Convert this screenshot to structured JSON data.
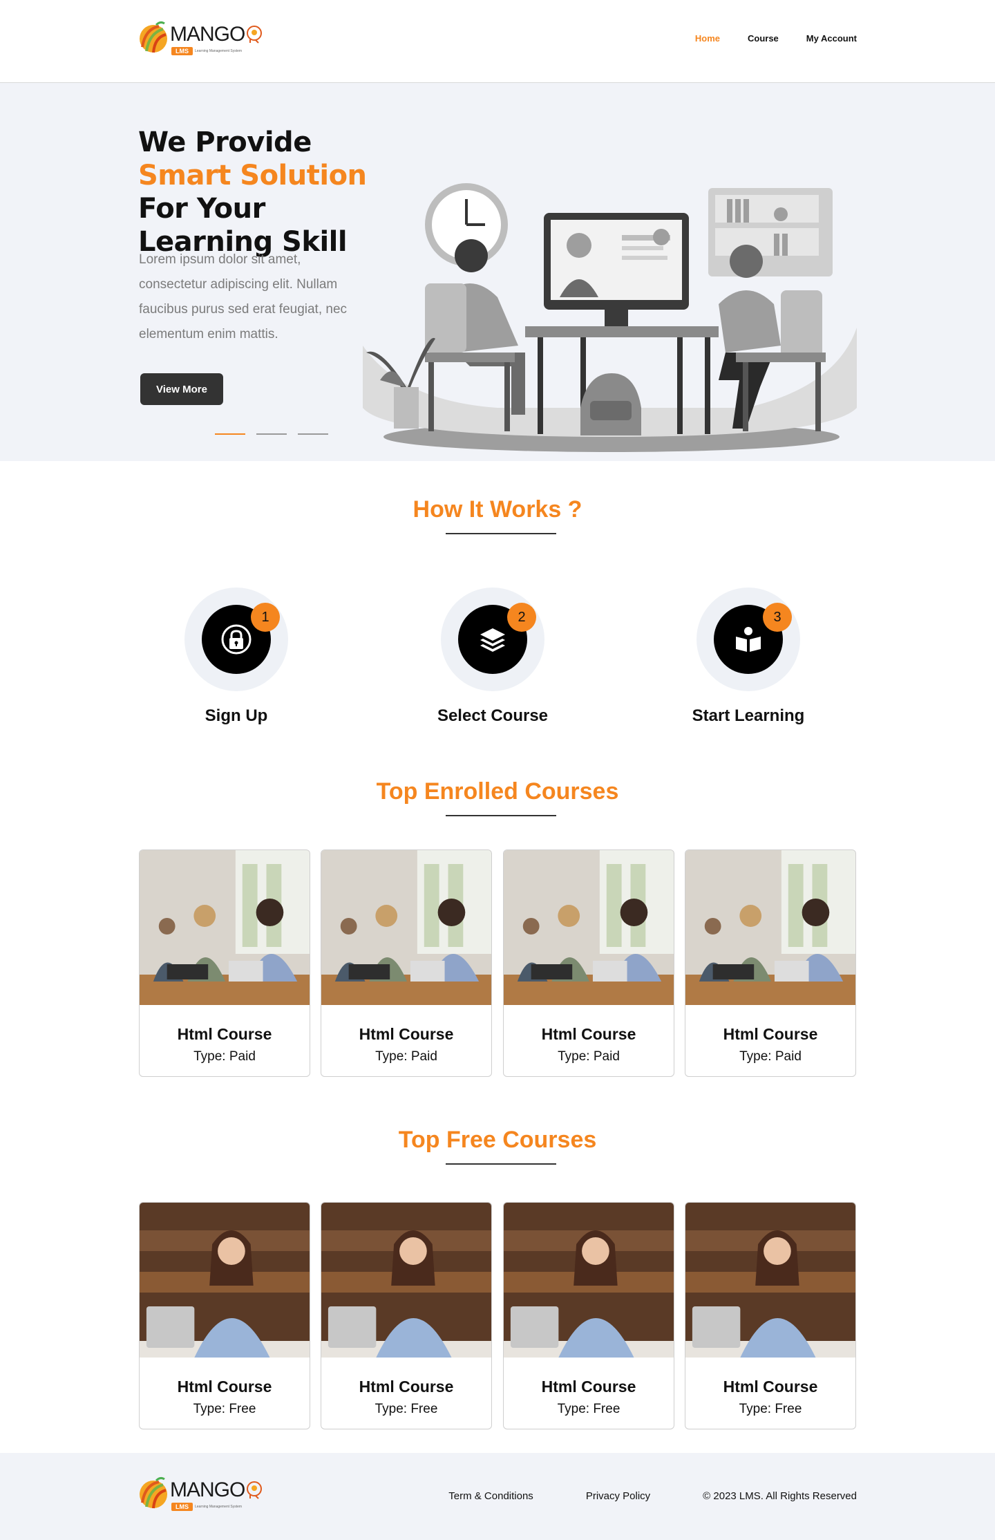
{
  "brand": {
    "name": "MANGO",
    "badge": "LMS",
    "tagline": "Learning Management System"
  },
  "nav": {
    "items": [
      "Home",
      "Course",
      "My Account"
    ],
    "active": "Home"
  },
  "hero": {
    "title_part1": "We Provide ",
    "title_highlight": "Smart Solution",
    "title_part2": " For Your Learning Skill",
    "description": "Lorem ipsum dolor sit amet, consectetur adipiscing elit. Nullam faucibus purus sed erat feugiat, nec elementum enim mattis.",
    "button_label": "View More",
    "slides_total": 3,
    "slides_active": 1
  },
  "how_it_works": {
    "title": "How It Works ?",
    "steps": [
      {
        "number": "1",
        "label": "Sign Up",
        "icon": "lock-icon"
      },
      {
        "number": "2",
        "label": "Select Course",
        "icon": "layers-icon"
      },
      {
        "number": "3",
        "label": "Start Learning",
        "icon": "open-book-icon"
      }
    ]
  },
  "top_enrolled": {
    "title": "Top Enrolled Courses",
    "courses": [
      {
        "title": "Html Course",
        "type": "Type: Paid"
      },
      {
        "title": "Html Course",
        "type": "Type: Paid"
      },
      {
        "title": "Html Course",
        "type": "Type: Paid"
      },
      {
        "title": "Html Course",
        "type": "Type: Paid"
      }
    ]
  },
  "top_free": {
    "title": "Top Free Courses",
    "courses": [
      {
        "title": "Html Course",
        "type": "Type: Free"
      },
      {
        "title": "Html Course",
        "type": "Type: Free"
      },
      {
        "title": "Html Course",
        "type": "Type: Free"
      },
      {
        "title": "Html Course",
        "type": "Type: Free"
      }
    ]
  },
  "footer": {
    "links": [
      "Term & Conditions",
      "Privacy Policy"
    ],
    "copyright": "© 2023 LMS. All Rights Reserved"
  },
  "colors": {
    "accent": "#f5861f",
    "dark_button": "#333333",
    "hero_bg": "#f1f3f8",
    "step_circle_bg": "#eef1f6"
  }
}
